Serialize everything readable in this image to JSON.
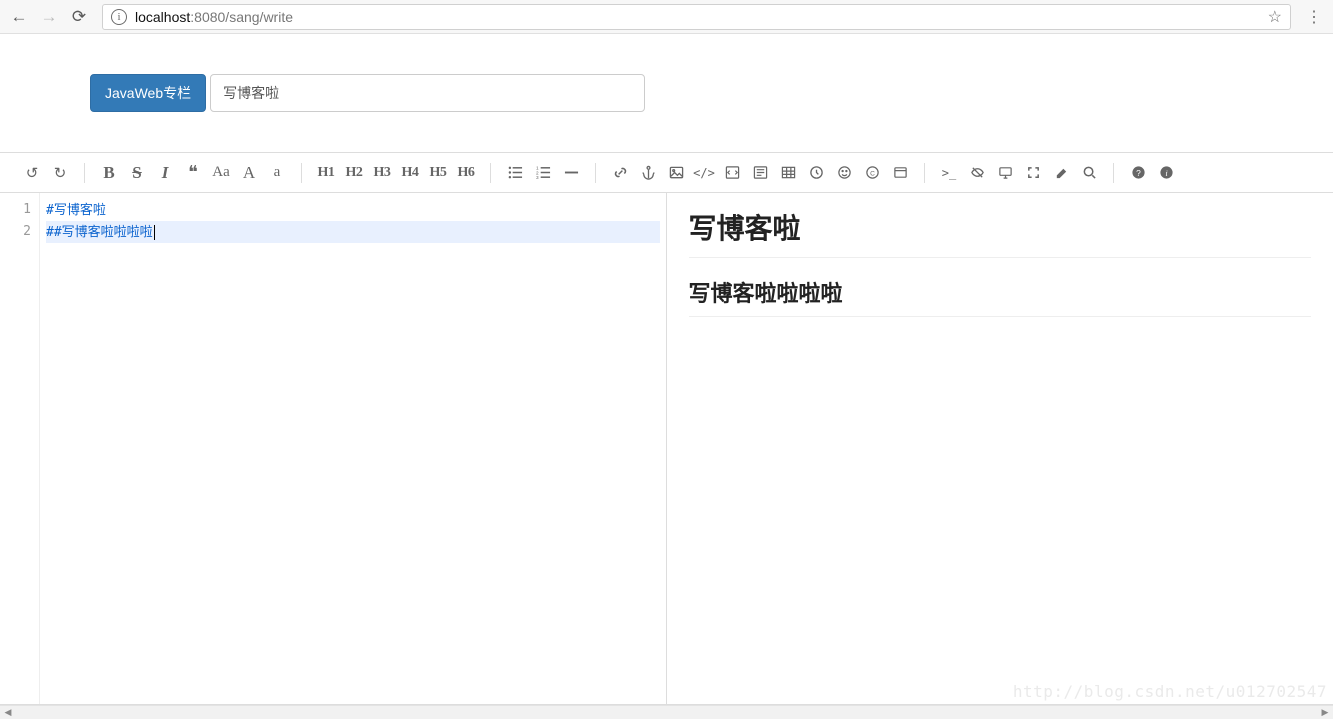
{
  "browser": {
    "url_host": "localhost",
    "url_rest": ":8080/sang/write"
  },
  "form": {
    "category_button": "JavaWeb专栏",
    "title_value": "写博客啦"
  },
  "toolbar": {
    "undo": "↺",
    "redo": "↻",
    "bold": "B",
    "strike": "S",
    "italic": "I",
    "quote": "❝",
    "aa_mixed": "Aa",
    "aa_upper": "A",
    "aa_lower": "a",
    "h1": "H1",
    "h2": "H2",
    "h3": "H3",
    "h4": "H4",
    "h5": "H5",
    "h6": "H6",
    "ul": "≣",
    "ol": "≣",
    "hr": "—",
    "link": "🔗",
    "anchor": "⚓",
    "image": "🖼",
    "code": "</>",
    "codeblock": "▤",
    "preformat": "▥",
    "table": "▦",
    "datetime": "🕘",
    "emoji": "☺",
    "copyright": "©",
    "pagebreak": "▭",
    "goto": ">_",
    "watch": "👁",
    "preview": "🖵",
    "fullscreen": "⤢",
    "clear": "✏",
    "search": "🔍",
    "help": "?",
    "info": "ⓘ"
  },
  "editor": {
    "lines": [
      {
        "num": "1",
        "hash": "#",
        "text": "写博客啦"
      },
      {
        "num": "2",
        "hash": "##",
        "text": "写博客啦啦啦啦"
      }
    ]
  },
  "preview": {
    "h1": "写博客啦",
    "h2": "写博客啦啦啦啦"
  },
  "watermark": "http://blog.csdn.net/u012702547"
}
